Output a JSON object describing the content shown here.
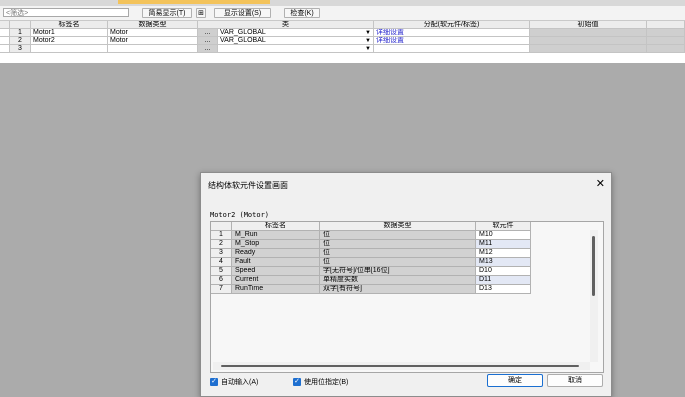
{
  "toolbar": {
    "filter_placeholder": "<筛选>",
    "simple_display": "简易显示(T)",
    "toggle_icon": "⊞",
    "display_settings": "显示设置(S)",
    "check": "检查(K)"
  },
  "grid": {
    "headers": [
      "标签名",
      "数据类型",
      "类",
      "分配(软元件/标签)",
      "初始值"
    ],
    "rows": [
      {
        "num": "1",
        "label": "Motor1",
        "type": "Motor",
        "btn": "...",
        "class": "VAR_GLOBAL",
        "assign": "详细设置"
      },
      {
        "num": "2",
        "label": "Motor2",
        "type": "Motor",
        "btn": "...",
        "class": "VAR_GLOBAL",
        "assign": "详细设置"
      },
      {
        "num": "3",
        "label": "",
        "type": "",
        "btn": "...",
        "class": "",
        "assign": ""
      }
    ]
  },
  "dialog": {
    "title": "结构体软元件设置画面",
    "close": "✕",
    "struct_label": "Motor2 (Motor)",
    "headers": [
      "标签名",
      "数据类型",
      "软元件"
    ],
    "rows": [
      {
        "num": "1",
        "name": "M_Run",
        "type": "位",
        "device": "M10"
      },
      {
        "num": "2",
        "name": "M_Stop",
        "type": "位",
        "device": "M11"
      },
      {
        "num": "3",
        "name": "Ready",
        "type": "位",
        "device": "M12"
      },
      {
        "num": "4",
        "name": "Fault",
        "type": "位",
        "device": "M13"
      },
      {
        "num": "5",
        "name": "Speed",
        "type": "字[无符号]/位串[16位]",
        "device": "D10"
      },
      {
        "num": "6",
        "name": "Current",
        "type": "单精度实数",
        "device": "D11"
      },
      {
        "num": "7",
        "name": "RunTime",
        "type": "双字[有符号]",
        "device": "D13"
      }
    ],
    "auto_input": "自动输入(A)",
    "use_bit": "使用位指定(B)",
    "ok": "确定",
    "cancel": "取消"
  }
}
